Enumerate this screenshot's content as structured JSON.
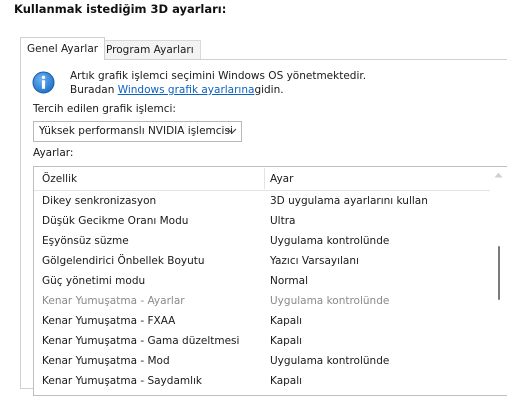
{
  "heading": "Kullanmak istediğim 3D ayarları:",
  "tabs": [
    {
      "label": "Genel Ayarlar",
      "active": true
    },
    {
      "label": "Program Ayarları",
      "active": false
    }
  ],
  "info": {
    "line1": "Artık grafik işlemci seçimini Windows OS yönetmektedir.",
    "line2_before": "Buradan ",
    "line2_link": "Windows grafik ayarlarına",
    "line2_after": "gidin."
  },
  "preferred_gpu": {
    "label": "Tercih edilen grafik işlemci:",
    "value": "Yüksek performanslı NVIDIA işlemcisi"
  },
  "settings": {
    "label": "Ayarlar:",
    "columns": [
      "Özellik",
      "Ayar"
    ],
    "rows": [
      {
        "feature": "Dikey senkronizasyon",
        "value": "3D uygulama ayarlarını kullan",
        "disabled": false
      },
      {
        "feature": "Düşük Gecikme Oranı Modu",
        "value": "Ultra",
        "disabled": false
      },
      {
        "feature": "Eşyönsüz süzme",
        "value": "Uygulama kontrolünde",
        "disabled": false
      },
      {
        "feature": "Gölgelendirici Önbellek Boyutu",
        "value": "Yazıcı Varsayılanı",
        "disabled": false
      },
      {
        "feature": "Güç yönetimi modu",
        "value": "Normal",
        "disabled": false
      },
      {
        "feature": "Kenar Yumuşatma - Ayarlar",
        "value": "Uygulama kontrolünde",
        "disabled": true
      },
      {
        "feature": "Kenar Yumuşatma - FXAA",
        "value": "Kapalı",
        "disabled": false
      },
      {
        "feature": "Kenar Yumuşatma - Gama düzeltmesi",
        "value": "Kapalı",
        "disabled": false
      },
      {
        "feature": "Kenar Yumuşatma - Mod",
        "value": "Uygulama kontrolünde",
        "disabled": false
      },
      {
        "feature": "Kenar Yumuşatma - Saydamlık",
        "value": "Kapalı",
        "disabled": false
      }
    ]
  },
  "icons": {
    "info": "info-icon",
    "dropdown": "chevron-down-icon",
    "scroll_up": "scroll-up-arrow-icon"
  },
  "colors": {
    "link": "#0b62c2",
    "info_icon": "#1b6fc9",
    "disabled_text": "#8a8a8a"
  }
}
